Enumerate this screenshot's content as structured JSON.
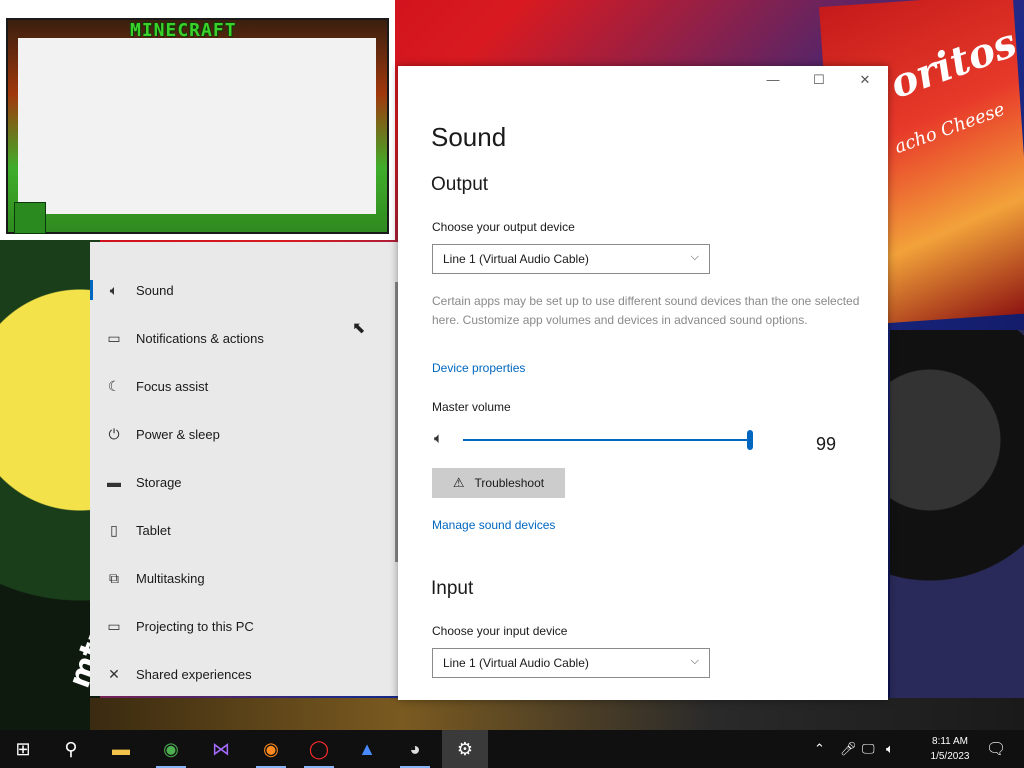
{
  "desktop": {
    "chips_brand": "oritos",
    "chips_flavor": "acho Cheese",
    "bottle_text": "mtn dew"
  },
  "overlay": {
    "title": "MINECRAFT"
  },
  "nav": {
    "items": [
      {
        "label": "Sound",
        "icon": "speaker-icon",
        "active": true
      },
      {
        "label": "Notifications & actions",
        "icon": "message-icon"
      },
      {
        "label": "Focus assist",
        "icon": "moon-icon"
      },
      {
        "label": "Power & sleep",
        "icon": "power-icon"
      },
      {
        "label": "Storage",
        "icon": "storage-icon"
      },
      {
        "label": "Tablet",
        "icon": "tablet-icon"
      },
      {
        "label": "Multitasking",
        "icon": "multitasking-icon"
      },
      {
        "label": "Projecting to this PC",
        "icon": "projector-icon"
      },
      {
        "label": "Shared experiences",
        "icon": "shared-icon"
      }
    ]
  },
  "window": {
    "controls": {
      "minimize": "—",
      "maximize": "☐",
      "close": "✕"
    },
    "title": "Sound",
    "output": {
      "heading": "Output",
      "device_label": "Choose your output device",
      "device_value": "Line 1 (Virtual Audio Cable)",
      "description": "Certain apps may be set up to use different sound devices than the one selected here. Customize app volumes and devices in advanced sound options.",
      "device_properties_link": "Device properties",
      "volume_label": "Master volume",
      "volume_value": "99",
      "volume_fraction": 0.99,
      "troubleshoot_label": "Troubleshoot",
      "manage_link": "Manage sound devices"
    },
    "input": {
      "heading": "Input",
      "device_label": "Choose your input device",
      "device_value": "Line 1 (Virtual Audio Cable)"
    }
  },
  "taskbar": {
    "apps": [
      "windows-start-icon",
      "search-icon",
      "file-explorer-icon",
      "chrome-icon",
      "visual-studio-icon",
      "firefox-icon",
      "opera-icon",
      "paint-icon",
      "obs-icon",
      "settings-icon"
    ],
    "time": "8:11 AM",
    "date": "1/5/2023"
  }
}
